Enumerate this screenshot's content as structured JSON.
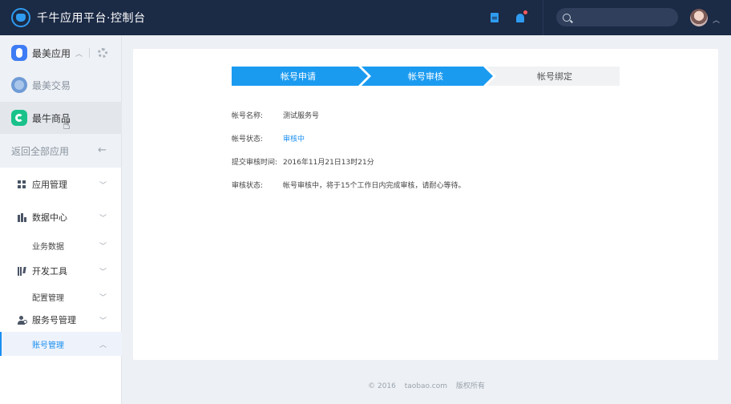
{
  "header": {
    "title": "千牛应用平台·控制台",
    "search_placeholder": "",
    "icons": [
      "logo-icon",
      "doc-icon",
      "bell-icon",
      "search-icon",
      "avatar",
      "chevron-up-icon"
    ],
    "accent": "#2f9bf0",
    "bg": "#1b2a45"
  },
  "sidebar": {
    "apps": [
      {
        "label": "最美应用",
        "icon": "app-icon"
      },
      {
        "label": "最美交易",
        "icon": "app-icon"
      },
      {
        "label": "最牛商品",
        "icon": "app-icon"
      }
    ],
    "back_label": "返回全部应用",
    "menu": [
      {
        "label": "应用管理",
        "icon": "grid-icon"
      },
      {
        "label": "数据中心",
        "icon": "bar-chart-icon"
      },
      {
        "label": "业务数据"
      },
      {
        "label": "开发工具",
        "icon": "tools-icon"
      },
      {
        "label": "配置管理"
      },
      {
        "label": "服务号管理",
        "icon": "user-gear-icon"
      },
      {
        "label": "账号管理",
        "active": true
      }
    ]
  },
  "steps": [
    {
      "label": "帐号申请",
      "state": "done"
    },
    {
      "label": "帐号审核",
      "state": "current"
    },
    {
      "label": "帐号绑定",
      "state": "todo"
    }
  ],
  "info": [
    {
      "key": "帐号名称:",
      "value": "测试服务号"
    },
    {
      "key": "帐号状态:",
      "value": "审核中"
    },
    {
      "key": "提交审核时间:",
      "value": "2016年11月21日13时21分"
    },
    {
      "key": "审核状态:",
      "value": "帐号审核中，将于15个工作日内完成审核，请耐心等待。"
    }
  ],
  "footer": {
    "copyright": "© 2016",
    "site": "taobao.com",
    "rights": "版权所有"
  },
  "colors": {
    "step_active": "#1b9bf0",
    "step_todo": "#f1f2f4",
    "status_blue": "#1b8ff0"
  }
}
